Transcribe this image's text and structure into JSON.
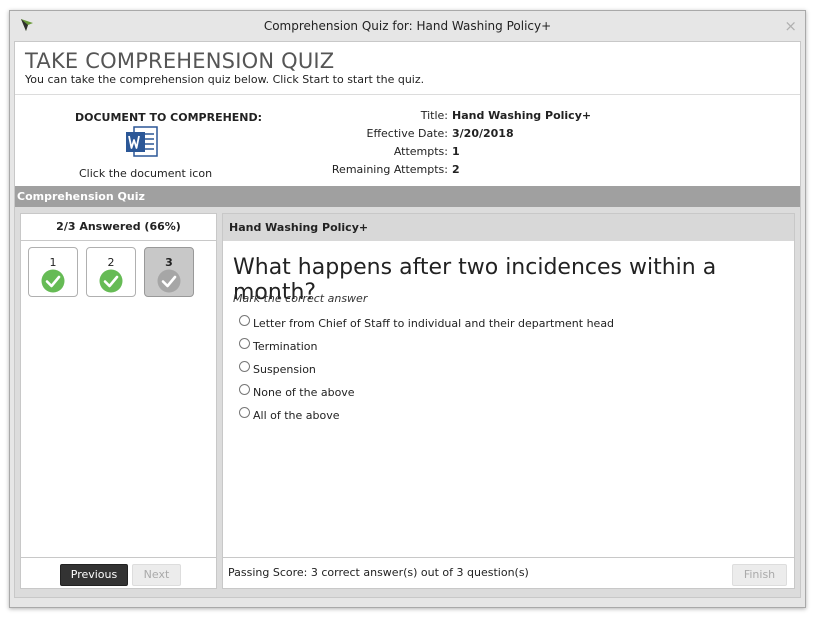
{
  "window": {
    "title": "Comprehension Quiz for: Hand Washing Policy+",
    "close_glyph": "×"
  },
  "header": {
    "title": "TAKE COMPREHENSION QUIZ",
    "subtitle": "You can take the comprehension quiz below. Click Start to start the quiz."
  },
  "document": {
    "label": "DOCUMENT TO COMPREHEND:",
    "icon": "word-document-icon",
    "hint": "Click the document icon"
  },
  "meta": [
    {
      "key": "Title:",
      "value": "Hand Washing Policy+"
    },
    {
      "key": "Effective Date:",
      "value": "3/20/2018"
    },
    {
      "key": "Attempts:",
      "value": "1"
    },
    {
      "key": "Remaining Attempts:",
      "value": "2"
    }
  ],
  "section": {
    "title": "Comprehension Quiz"
  },
  "progress": {
    "label": "2/3 Answered (66%)",
    "questions": [
      {
        "number": "1",
        "status": "answered"
      },
      {
        "number": "2",
        "status": "answered"
      },
      {
        "number": "3",
        "status": "current"
      }
    ]
  },
  "nav": {
    "previous": "Previous",
    "next": "Next"
  },
  "quiz": {
    "doc_title": "Hand Washing Policy+",
    "question": "What happens after two incidences within a month?",
    "instruction": "Mark the correct answer",
    "answers": [
      "Letter from Chief of Staff to individual and their department head",
      "Termination",
      "Suspension",
      "None of the above",
      "All of the above"
    ],
    "passing": "Passing Score: 3 correct answer(s) out of 3 question(s)",
    "finish": "Finish"
  },
  "colors": {
    "check_green": "#66bb55",
    "check_grey": "#a6a6a6",
    "word_blue": "#2b5797",
    "section_bar": "#a0a0a0"
  }
}
